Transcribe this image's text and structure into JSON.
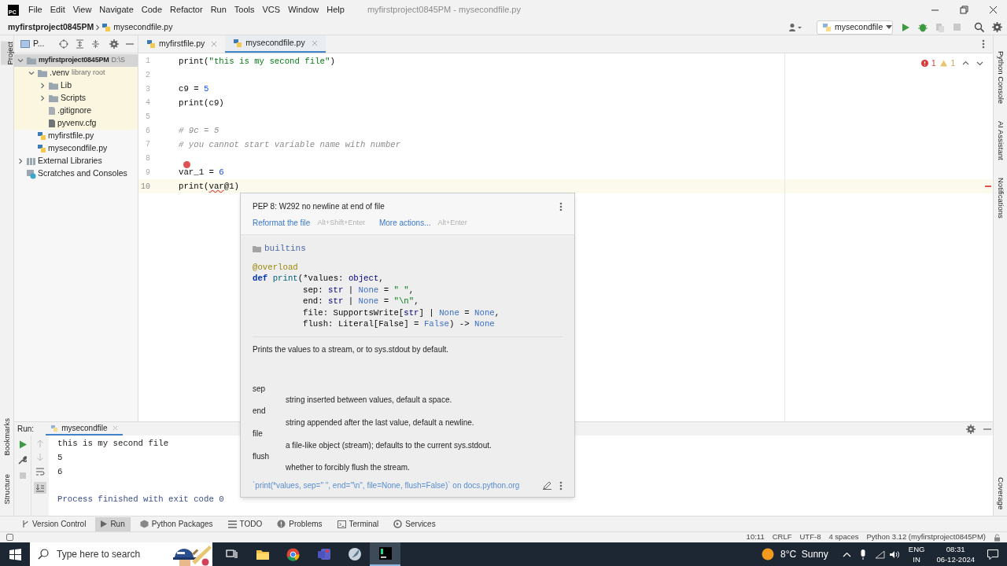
{
  "title_bar": {
    "logo": "PC",
    "menu": [
      "File",
      "Edit",
      "View",
      "Navigate",
      "Code",
      "Refactor",
      "Run",
      "Tools",
      "VCS",
      "Window",
      "Help"
    ],
    "title": "myfirstproject0845PM - mysecondfile.py"
  },
  "nav_bar": {
    "project": "myfirstproject0845PM",
    "file": "mysecondfile.py",
    "run_config": "mysecondfile"
  },
  "left_strip": {
    "top": [
      {
        "label": "Project",
        "selected": true
      }
    ],
    "bottom": [
      {
        "label": "Bookmarks",
        "selected": false
      },
      {
        "label": "Structure",
        "selected": false
      }
    ]
  },
  "right_strip": {
    "top": [
      {
        "label": "Python Console",
        "selected": false
      },
      {
        "label": "AI Assistant",
        "selected": false
      },
      {
        "label": "Notifications",
        "selected": false
      }
    ],
    "bottom": [
      {
        "label": "Coverage",
        "selected": false
      }
    ]
  },
  "project_panel": {
    "title": "P...",
    "tree": [
      {
        "label": "myfirstproject0845PM",
        "note": "D:\\S",
        "kind": "project",
        "expanded": true,
        "selected": true,
        "children": [
          {
            "label": ".venv",
            "note": "library root",
            "kind": "folder",
            "expanded": true,
            "selected": false,
            "library": true,
            "children": [
              {
                "label": "Lib",
                "kind": "folder",
                "expanded": false,
                "selected": false
              },
              {
                "label": "Scripts",
                "kind": "folder",
                "expanded": false,
                "selected": false
              },
              {
                "label": ".gitignore",
                "kind": "text",
                "selected": false
              },
              {
                "label": "pyvenv.cfg",
                "kind": "config",
                "selected": false
              }
            ]
          },
          {
            "label": "myfirstfile.py",
            "kind": "python",
            "selected": false
          },
          {
            "label": "mysecondfile.py",
            "kind": "python",
            "selected": false
          }
        ]
      },
      {
        "label": "External Libraries",
        "kind": "library",
        "expanded": false,
        "selected": false
      },
      {
        "label": "Scratches and Consoles",
        "kind": "scratches",
        "selected": false
      }
    ]
  },
  "editor": {
    "tabs": [
      {
        "label": "myfirstfile.py",
        "selected": false
      },
      {
        "label": "mysecondfile.py",
        "selected": true
      }
    ],
    "errors": "1",
    "warnings": "1",
    "lines": [
      {
        "number": "1",
        "current": false,
        "tokens": [
          {
            "text": "print(",
            "kind": "plain"
          },
          {
            "text": "\"this is my second file\"",
            "kind": "string"
          },
          {
            "text": ")",
            "kind": "plain"
          }
        ]
      },
      {
        "number": "2",
        "current": false
      },
      {
        "number": "3",
        "current": false,
        "tokens": [
          {
            "text": "c9 = ",
            "kind": "plain"
          },
          {
            "text": "5",
            "kind": "number"
          }
        ]
      },
      {
        "number": "4",
        "current": false,
        "tokens": [
          {
            "text": "print(c9)",
            "kind": "plain"
          }
        ]
      },
      {
        "number": "5",
        "current": false
      },
      {
        "number": "6",
        "current": false,
        "tokens": [
          {
            "text": "# 9c = 5",
            "kind": "comment"
          }
        ]
      },
      {
        "number": "7",
        "current": false,
        "tokens": [
          {
            "text": "# you cannot start variable name with number",
            "kind": "comment"
          }
        ]
      },
      {
        "number": "8",
        "current": false
      },
      {
        "number": "9",
        "current": false,
        "error_icon": true,
        "tokens": [
          {
            "text": "var_1 = ",
            "kind": "plain"
          },
          {
            "text": "6",
            "kind": "number"
          }
        ]
      },
      {
        "number": "10",
        "current": true,
        "tokens": [
          {
            "text": "print(",
            "kind": "plain"
          },
          {
            "text": "var",
            "kind": "error"
          },
          {
            "text": "@1)",
            "kind": "plain"
          }
        ]
      }
    ]
  },
  "popup": {
    "problem": "PEP 8: W292 no newline at end of file",
    "actions": [
      {
        "label": "Reformat the file",
        "shortcut": "Alt+Shift+Enter"
      },
      {
        "label": "More actions...",
        "shortcut": "Alt+Enter"
      }
    ],
    "module": "builtins",
    "signature": [
      {
        "indent": false,
        "tokens": [
          {
            "text": "@overload",
            "kind": "decorator"
          }
        ]
      },
      {
        "indent": false,
        "tokens": [
          {
            "text": "def ",
            "kind": "keyword"
          },
          {
            "text": "print",
            "kind": "function"
          },
          {
            "text": "(*values: ",
            "kind": "plain"
          },
          {
            "text": "object",
            "kind": "builtin"
          },
          {
            "text": ",",
            "kind": "plain"
          }
        ]
      },
      {
        "indent": true,
        "tokens": [
          {
            "text": "sep: ",
            "kind": "plain"
          },
          {
            "text": "str",
            "kind": "builtin"
          },
          {
            "text": " | ",
            "kind": "plain"
          },
          {
            "text": "None",
            "kind": "const"
          },
          {
            "text": " = ",
            "kind": "plain"
          },
          {
            "text": "\" \"",
            "kind": "string"
          },
          {
            "text": ",",
            "kind": "plain"
          }
        ]
      },
      {
        "indent": true,
        "tokens": [
          {
            "text": "end: ",
            "kind": "plain"
          },
          {
            "text": "str",
            "kind": "builtin"
          },
          {
            "text": " | ",
            "kind": "plain"
          },
          {
            "text": "None",
            "kind": "const"
          },
          {
            "text": " = ",
            "kind": "plain"
          },
          {
            "text": "\"\\n\"",
            "kind": "string"
          },
          {
            "text": ",",
            "kind": "plain"
          }
        ]
      },
      {
        "indent": true,
        "tokens": [
          {
            "text": "file: SupportsWrite[",
            "kind": "plain"
          },
          {
            "text": "str",
            "kind": "builtin"
          },
          {
            "text": "] | ",
            "kind": "plain"
          },
          {
            "text": "None",
            "kind": "const"
          },
          {
            "text": " = ",
            "kind": "plain"
          },
          {
            "text": "None",
            "kind": "const"
          },
          {
            "text": ",",
            "kind": "plain"
          }
        ]
      },
      {
        "indent": true,
        "tokens": [
          {
            "text": "flush: Literal[False] = ",
            "kind": "plain"
          },
          {
            "text": "False",
            "kind": "const"
          },
          {
            "text": ") -> ",
            "kind": "plain"
          },
          {
            "text": "None",
            "kind": "const"
          }
        ]
      }
    ],
    "description": "Prints the values to a stream, or to sys.stdout by default.",
    "params": [
      {
        "name": "sep",
        "text": "string inserted between values, default a space."
      },
      {
        "name": "end",
        "text": "string appended after the last value, default a newline."
      },
      {
        "name": "file",
        "text": "a file-like object (stream); defaults to the current sys.stdout."
      },
      {
        "name": "flush",
        "text": "whether to forcibly flush the stream."
      }
    ],
    "footer_link": "`print(*values, sep=\" \", end=\"\\n\", file=None, flush=False)` on docs.python.org"
  },
  "run_panel": {
    "label": "Run:",
    "tab": "mysecondfile",
    "soft_wrap": false,
    "scroll_to_end": true,
    "output": [
      {
        "text": "this is my second file",
        "kind": "stdout"
      },
      {
        "text": "5",
        "kind": "stdout"
      },
      {
        "text": "6",
        "kind": "stdout"
      },
      {
        "text": "Process finished with exit code 0",
        "kind": "system"
      }
    ]
  },
  "tool_windows": [
    {
      "label": "Version Control",
      "kind": "vcs",
      "selected": false
    },
    {
      "label": "Run",
      "kind": "run",
      "selected": true
    },
    {
      "label": "Python Packages",
      "kind": "packages",
      "selected": false
    },
    {
      "label": "TODO",
      "kind": "todo",
      "selected": false
    },
    {
      "label": "Problems",
      "kind": "problems",
      "selected": false
    },
    {
      "label": "Terminal",
      "kind": "terminal",
      "selected": false
    },
    {
      "label": "Services",
      "kind": "services",
      "selected": false
    }
  ],
  "status_bar": [
    "10:11",
    "CRLF",
    "UTF-8",
    "4 spaces",
    "Python 3.12 (myfirstproject0845PM)"
  ],
  "taskbar": {
    "search_placeholder": "Type here to search",
    "apps": [
      {
        "kind": "task-view",
        "active": false
      },
      {
        "kind": "explorer",
        "active": false
      },
      {
        "kind": "circle",
        "active": false
      },
      {
        "kind": "tile",
        "active": false
      },
      {
        "kind": "quill",
        "active": false
      },
      {
        "kind": "ide",
        "active": true
      }
    ],
    "weather": "8°C  Sunny",
    "language": "ENG",
    "region": "IN",
    "time": "08:31",
    "date": "06-12-2024"
  }
}
